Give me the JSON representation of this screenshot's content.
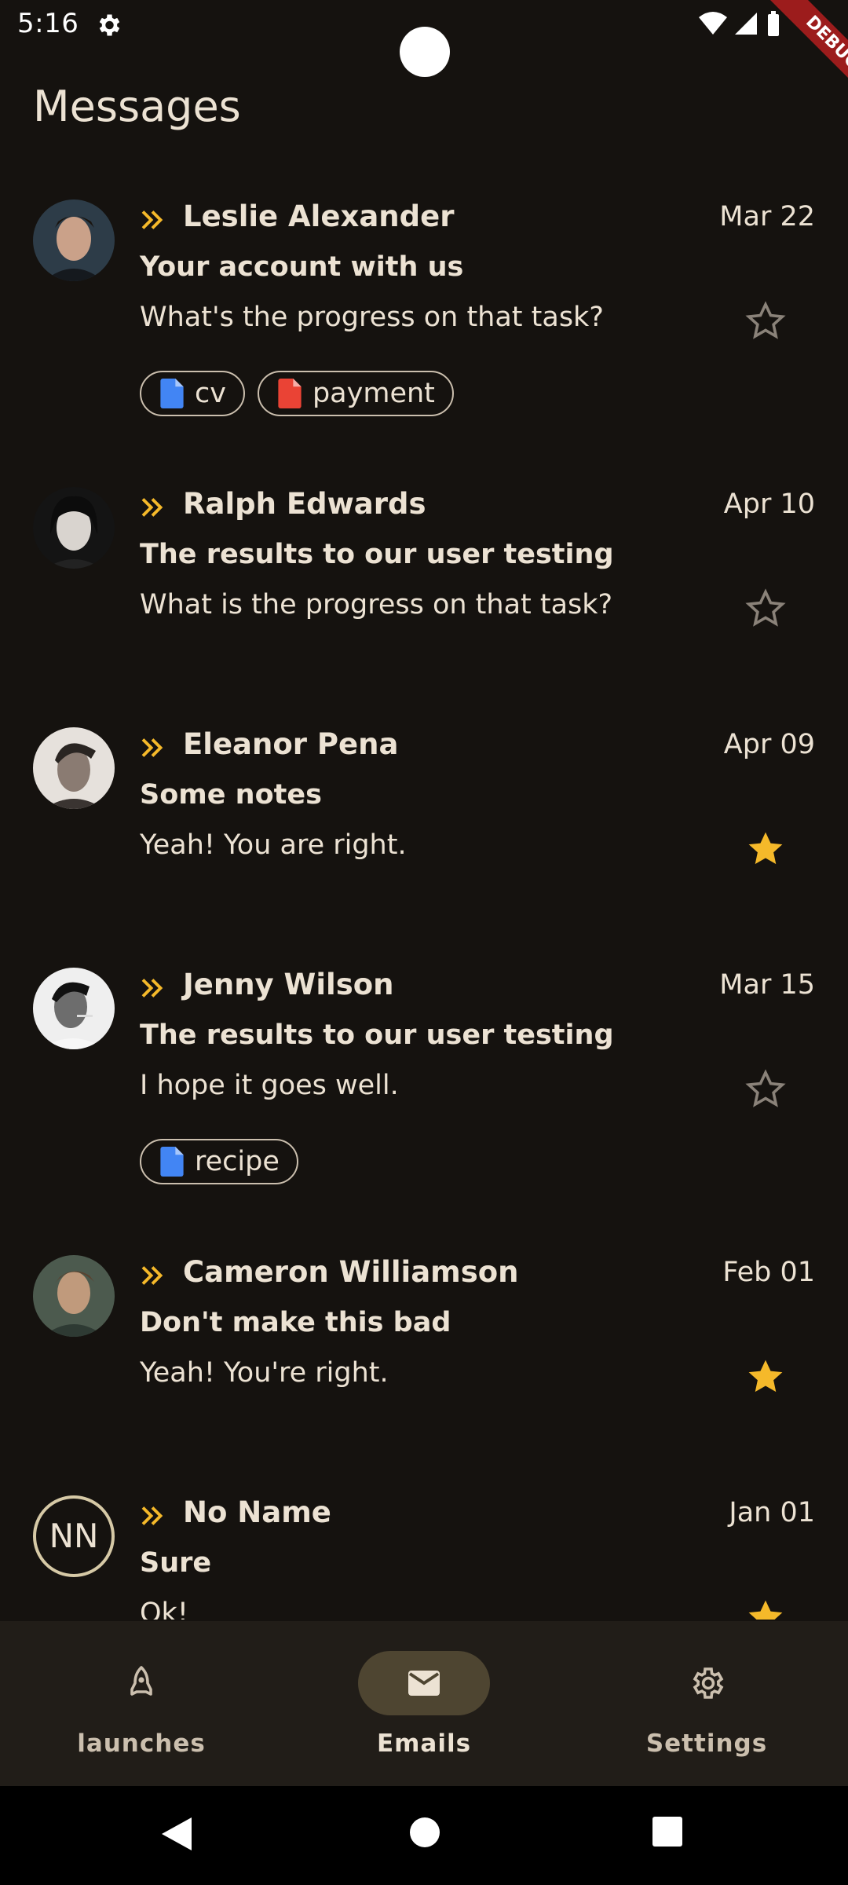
{
  "status_bar": {
    "time": "5:16",
    "debug_label": "DEBUG"
  },
  "app": {
    "title": "Messages"
  },
  "messages": [
    {
      "sender": "Leslie Alexander",
      "date": "Mar 22",
      "subject": "Your account with us",
      "preview": "What's the progress on that task?",
      "starred": false,
      "attachments": [
        {
          "label": "cv",
          "color": "#4285f4"
        },
        {
          "label": "payment",
          "color": "#ea4335"
        }
      ]
    },
    {
      "sender": "Ralph Edwards",
      "date": "Apr 10",
      "subject": "The results to our user testing",
      "preview": "What is the progress on that task?",
      "starred": false,
      "attachments": []
    },
    {
      "sender": "Eleanor Pena",
      "date": "Apr 09",
      "subject": "Some notes",
      "preview": "Yeah! You are right.",
      "starred": true,
      "attachments": []
    },
    {
      "sender": "Jenny Wilson",
      "date": "Mar 15",
      "subject": "The results to our user testing",
      "preview": "I hope it goes well.",
      "starred": false,
      "attachments": [
        {
          "label": "recipe",
          "color": "#4285f4"
        }
      ]
    },
    {
      "sender": "Cameron Williamson",
      "date": "Feb 01",
      "subject": "Don't make this bad",
      "preview": "Yeah! You're right.",
      "starred": true,
      "attachments": []
    },
    {
      "sender": "No Name",
      "initials": "NN",
      "date": "Jan 01",
      "subject": "Sure",
      "preview": "Ok!",
      "starred": true,
      "attachments": []
    }
  ],
  "bottom_nav": [
    {
      "label": "launches",
      "icon": "rocket-icon",
      "active": false
    },
    {
      "label": "Emails",
      "icon": "mail-icon",
      "active": true
    },
    {
      "label": "Settings",
      "icon": "gear-icon",
      "active": false
    }
  ],
  "colors": {
    "accent": "#f5b92a",
    "background": "#15120f",
    "nav_bar": "#211d18",
    "active_pill": "#4e4531"
  }
}
